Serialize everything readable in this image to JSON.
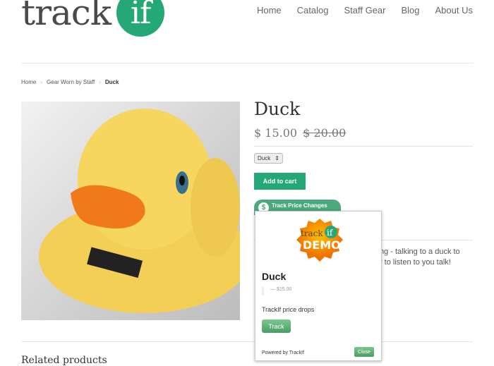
{
  "logo": {
    "text": "track",
    "badge": "if"
  },
  "nav": [
    "Home",
    "Catalog",
    "Staff Gear",
    "Blog",
    "About Us"
  ],
  "breadcrumb": [
    "Home",
    "Gear Worn by Staff",
    "Duck"
  ],
  "product": {
    "title": "Duck",
    "price": "$ 15.00",
    "old_price": "$ 20.00",
    "variant": "Duck",
    "add_to_cart": "Add to cart",
    "track_button": "Track Price Changes",
    "description_line1": "king - talking to a duck to",
    "description_line2": "dy to listen to you talk!"
  },
  "related": "Related products",
  "popup": {
    "badge_top": "track",
    "badge_if": "if",
    "badge_demo": "DEMO",
    "title": "Duck",
    "price": "— $15.00",
    "drops": "TrackIf price drops",
    "track": "Track",
    "powered": "Powered by TrackIf",
    "close": "Close"
  },
  "colors": {
    "brand": "#25a878"
  }
}
